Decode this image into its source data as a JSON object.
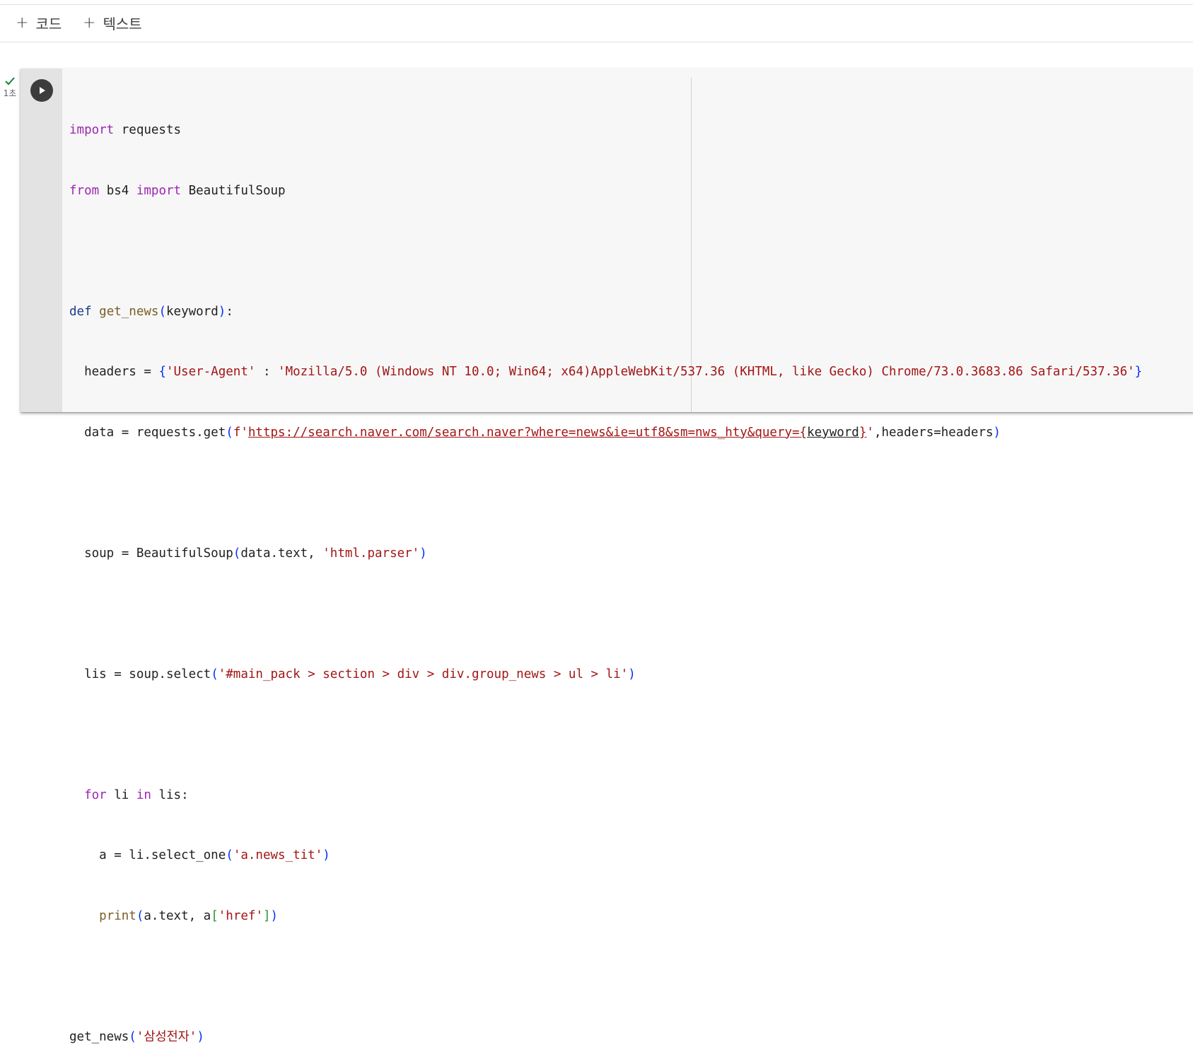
{
  "toolbar": {
    "add_code_label": "코드",
    "add_text_label": "텍스트",
    "plus": "+"
  },
  "cell": {
    "status_icon": "check-icon",
    "exec_time": "1초",
    "lines": [
      {
        "kw": "import",
        "rest": " requests"
      },
      {
        "kw1": "from",
        "mid": " bs4 ",
        "kw2": "import",
        "rest": " BeautifulSoup"
      },
      {
        "blank": ""
      },
      {
        "def": "def",
        "sp": " ",
        "fn": "get_news",
        "open": "(",
        "arg": "keyword",
        "close": ")",
        "colon": ":"
      },
      {
        "pre": "  headers = ",
        "open": "{",
        "k": "'User-Agent'",
        "sep": " : ",
        "v": "'Mozilla/5.0 (Windows NT 10.0; Win64; x64)AppleWebKit/537.36 (KHTML, like Gecko) Chrome/73.0.3683.86 Safari/537.36'",
        "close": "}"
      },
      {
        "pre": "  data = requests.get",
        "open": "(",
        "f": "f'",
        "url": "https://search.naver.com/search.naver?where=news&ie=utf8&sm=nws_hty&query=",
        "iopen": "{",
        "ivar": "keyword",
        "iclose": "}",
        "q": "'",
        "rest": ",headers=headers",
        "close": ")"
      },
      {
        "blank": ""
      },
      {
        "pre": "  soup = BeautifulSoup",
        "open": "(",
        "mid": "data.text, ",
        "str": "'html.parser'",
        "close": ")"
      },
      {
        "blank": ""
      },
      {
        "pre": "  lis = soup.select",
        "open": "(",
        "str": "'#main_pack > section > div > div.group_news > ul > li'",
        "close": ")"
      },
      {
        "blank": ""
      },
      {
        "indent": "  ",
        "kw1": "for",
        "mid": " li ",
        "kw2": "in",
        "rest": " lis:"
      },
      {
        "pre": "    a = li.select_one",
        "open": "(",
        "str": "'a.news_tit'",
        "close": ")"
      },
      {
        "indent": "    ",
        "fn": "print",
        "open": "(",
        "mid": "a.text, a",
        "bopen": "[",
        "str": "'href'",
        "bclose": "]",
        "close": ")"
      },
      {
        "blank": ""
      },
      {
        "pre": "get_news",
        "open": "(",
        "str": "'삼성전자'",
        "close": ")"
      }
    ]
  }
}
